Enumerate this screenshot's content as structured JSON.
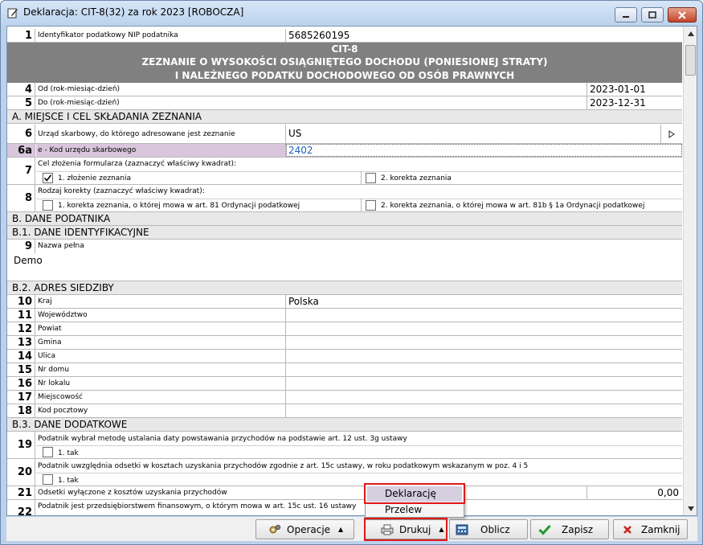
{
  "window": {
    "title": "Deklaracja: CIT-8(32) za rok 2023  [ROBOCZA]",
    "icon": "form-edit-icon"
  },
  "header": {
    "line1": "CIT-8",
    "line2": "ZEZNANIE O WYSOKOŚCI OSIĄGNIĘTEGO DOCHODU (PONIESIONEJ STRATY)",
    "line3": "I NALEŻNEGO PODATKU DOCHODOWEGO OD OSÓB PRAWNYCH"
  },
  "fields": {
    "f1": {
      "num": "1",
      "label": "Identyfikator podatkowy NIP podatnika",
      "value": "5685260195"
    },
    "f4": {
      "num": "4",
      "label": "Od (rok-miesiąc-dzień)",
      "value": "2023-01-01"
    },
    "f5": {
      "num": "5",
      "label": "Do (rok-miesiąc-dzień)",
      "value": "2023-12-31"
    },
    "f6": {
      "num": "6",
      "label": "Urząd skarbowy, do którego adresowane jest zeznanie",
      "value": "US"
    },
    "f6a": {
      "num": "6a",
      "label": "e - Kod urzędu skarbowego",
      "value": "2402"
    },
    "f7": {
      "num": "7",
      "label": "Cel złożenia formularza (zaznaczyć właściwy kwadrat):",
      "opt1": "1. złożenie zeznania",
      "opt2": "2. korekta zeznania"
    },
    "f8": {
      "num": "8",
      "label": "Rodzaj korekty (zaznaczyć właściwy kwadrat):",
      "opt1": "1.  korekta zeznania, o której mowa w art. 81 Ordynacji podatkowej",
      "opt2": "2.  korekta zeznania, o której mowa w art. 81b § 1a Ordynacji podatkowej"
    },
    "f9": {
      "num": "9",
      "label": "Nazwa pełna",
      "value": "Demo"
    },
    "f10": {
      "num": "10",
      "label": "Kraj",
      "value": "Polska"
    },
    "f11": {
      "num": "11",
      "label": "Województwo"
    },
    "f12": {
      "num": "12",
      "label": "Powiat"
    },
    "f13": {
      "num": "13",
      "label": "Gmina"
    },
    "f14": {
      "num": "14",
      "label": "Ulica"
    },
    "f15": {
      "num": "15",
      "label": "Nr domu"
    },
    "f16": {
      "num": "16",
      "label": "Nr lokalu"
    },
    "f17": {
      "num": "17",
      "label": "Miejscowość"
    },
    "f18": {
      "num": "18",
      "label": "Kod pocztowy"
    },
    "f19": {
      "num": "19",
      "label": "Podatnik wybrał metodę ustalania daty powstawania przychodów na podstawie art. 12 ust. 3g ustawy",
      "opt1": "1. tak"
    },
    "f20": {
      "num": "20",
      "label": "Podatnik uwzględnia odsetki w kosztach uzyskania przychodów zgodnie z art. 15c ustawy, w roku podatkowym wskazanym w poz. 4 i 5",
      "opt1": "1. tak"
    },
    "f21": {
      "num": "21",
      "label": "Odsetki wyłączone z kosztów uzyskania przychodów",
      "value": "0,00"
    },
    "f22": {
      "num": "22",
      "label": "Podatnik jest przedsiębiorstwem finansowym, o którym mowa  w art. 15c ust. 16 ustawy"
    }
  },
  "sections": {
    "a": "A. MIEJSCE I CEL SKŁADANIA ZEZNANIA",
    "b": "B. DANE PODATNIKA",
    "b1": "B.1. DANE IDENTYFIKACYJNE",
    "b2": "B.2. ADRES SIEDZIBY",
    "b3": "B.3. DANE DODATKOWE"
  },
  "toolbar": {
    "operacje": "Operacje",
    "drukuj": "Drukuj",
    "oblicz": "Oblicz",
    "zapisz": "Zapisz",
    "zamknij": "Zamknij"
  },
  "popup": {
    "items": [
      "Deklarację",
      "Przelew"
    ]
  },
  "colors": {
    "header_bg": "#808080",
    "highlight_row": "#d9c6dd",
    "link_value": "#1f5fbf",
    "annotation": "#e01818"
  }
}
